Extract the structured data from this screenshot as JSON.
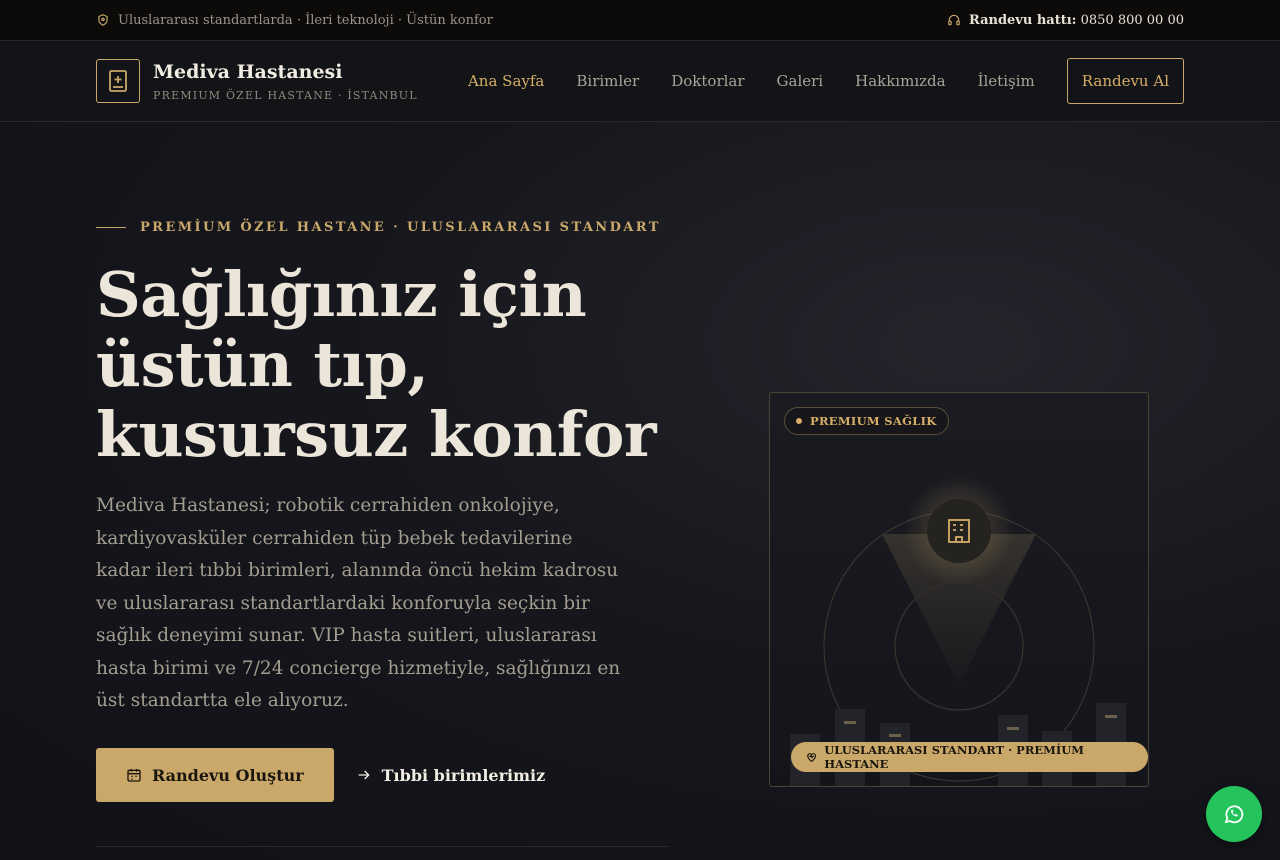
{
  "topbar": {
    "tagline": "Uluslararası standartlarda · İleri teknoloji · Üstün konfor",
    "hotline_label": "Randevu hattı:",
    "hotline_number": "0850 800 00 00"
  },
  "nav": {
    "brand_name": "Mediva Hastanesi",
    "brand_sub": "PREMIUM ÖZEL HASTANE · İSTANBUL",
    "items": [
      {
        "label": "Ana Sayfa",
        "active": true
      },
      {
        "label": "Birimler"
      },
      {
        "label": "Doktorlar"
      },
      {
        "label": "Galeri"
      },
      {
        "label": "Hakkımızda"
      },
      {
        "label": "İletişim"
      }
    ],
    "cta": "Randevu Al"
  },
  "hero": {
    "eyebrow": "PREMİUM ÖZEL HASTANE · ULUSLARARASI STANDART",
    "title": "Sağlığınız için üstün tıp, kusursuz konfor",
    "lead": "Mediva Hastanesi; robotik cerrahiden onkolojiye, kardiyovasküler cerrahiden tüp bebek tedavilerine kadar ileri tıbbi birimleri, alanında öncü hekim kadrosu ve uluslararası standartlardaki konforuyla seçkin bir sağlık deneyimi sunar. VIP hasta suitleri, uluslararası hasta birimi ve 7/24 concierge hizmetiyle, sağlığınızı en üst standartta ele alıyoruz.",
    "primary_button": "Randevu Oluştur",
    "secondary_link": "Tıbbi birimlerimiz"
  },
  "card": {
    "badge_top": "PREMIUM SAĞLIK",
    "badge_bottom": "ULUSLARARASI STANDART · PREMİUM HASTANE"
  },
  "colors": {
    "accent": "#c9a86a",
    "background": "#111318",
    "whatsapp": "#24c35c"
  }
}
